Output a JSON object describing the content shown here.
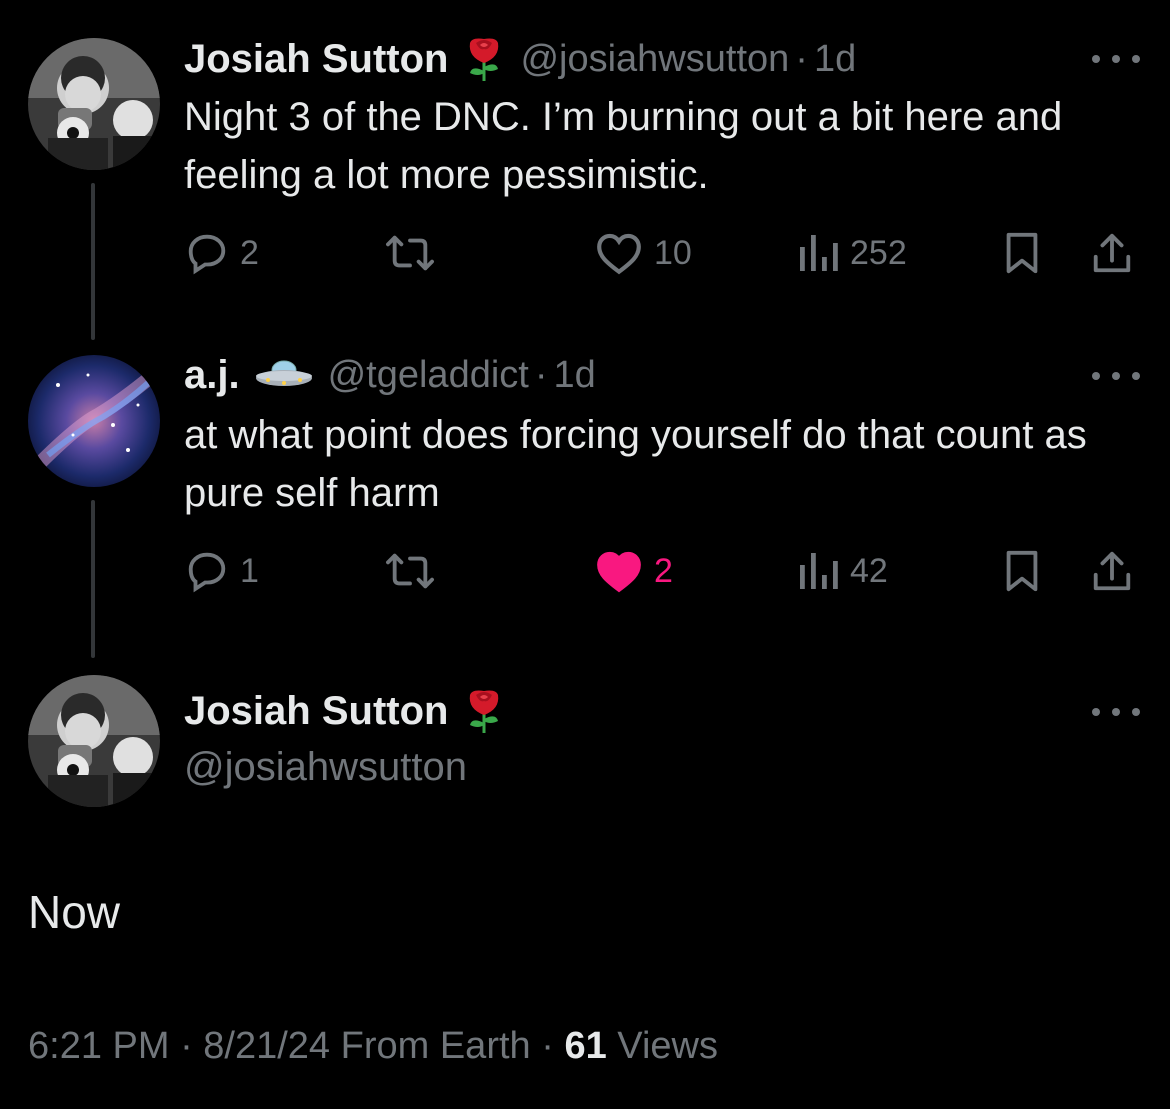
{
  "tweets": [
    {
      "display_name": "Josiah Sutton",
      "handle": "@josiahwsutton",
      "separator": "·",
      "time": "1d",
      "text": "Night 3 of the DNC. I’m burning out a bit here and feeling a lot more pessimistic.",
      "replies": "2",
      "retweets": "",
      "likes": "10",
      "views": "252",
      "liked": false,
      "name_emoji": "rose-icon"
    },
    {
      "display_name": "a.j.",
      "handle": "@tgeladdict",
      "separator": "·",
      "time": "1d",
      "text": "at what point does forcing yourself do that count as pure self harm",
      "replies": "1",
      "retweets": "",
      "likes": "2",
      "views": "42",
      "liked": true,
      "name_emoji": "ufo-icon"
    }
  ],
  "main_tweet": {
    "display_name": "Josiah Sutton",
    "handle": "@josiahwsutton",
    "name_emoji": "rose-icon",
    "text": "Now",
    "timestamp": "6:21 PM · 8/21/24 From Earth · ",
    "views_count": "61",
    "views_label": "Views"
  },
  "colors": {
    "background": "#000000",
    "text": "#e7e9ea",
    "secondary": "#71767b",
    "like": "#f91880",
    "thread_line": "#333639"
  }
}
